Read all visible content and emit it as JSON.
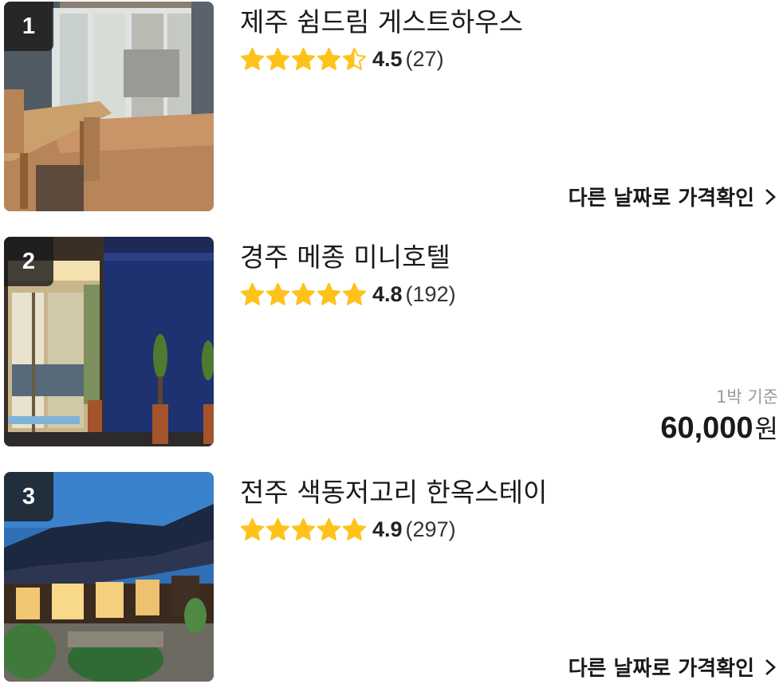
{
  "listings": [
    {
      "rank": "1",
      "title": "제주 쉼드림 게스트하우스",
      "rating": 4.5,
      "score_label": "4.5",
      "review_count": "(27)",
      "action_label": "다른 날짜로 가격확인"
    },
    {
      "rank": "2",
      "title": "경주 메종 미니호텔",
      "rating": 4.8,
      "score_label": "4.8",
      "review_count": "(192)",
      "price_basis": "1박 기준",
      "price_amount": "60,000",
      "price_unit": "원"
    },
    {
      "rank": "3",
      "title": "전주 색동저고리 한옥스테이",
      "rating": 4.9,
      "score_label": "4.9",
      "review_count": "(297)",
      "action_label": "다른 날짜로 가격확인"
    }
  ],
  "colors": {
    "star_fill": "#FFC21A",
    "star_empty": "#FFFFFF",
    "rank_badge": "#1C1C1C",
    "price_basis_text": "#9A9A9A"
  },
  "icons": {
    "star": "star-icon",
    "half_star": "star-half-icon",
    "chevron": "chevron-right-icon"
  }
}
